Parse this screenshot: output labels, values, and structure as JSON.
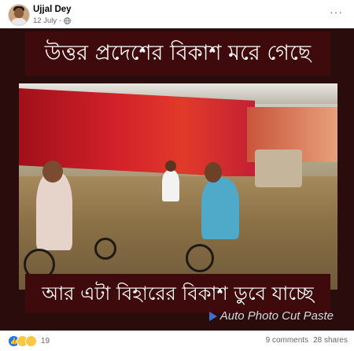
{
  "post": {
    "author": "Ujjal Dey",
    "date": "12 July",
    "separator": "·",
    "more": "···"
  },
  "image": {
    "caption_top": "উত্তর প্রদেশের বিকাশ মরে গেছে",
    "caption_bottom": "আর এটা বিহারের বিকাশ ডুবে যাচ্ছে",
    "watermark": "Auto Photo Cut Paste"
  },
  "footer": {
    "reaction_count": "19",
    "comments": "9 comments",
    "shares": "28 shares",
    "reactions": [
      "like-icon",
      "haha-icon",
      "wow-icon"
    ]
  }
}
